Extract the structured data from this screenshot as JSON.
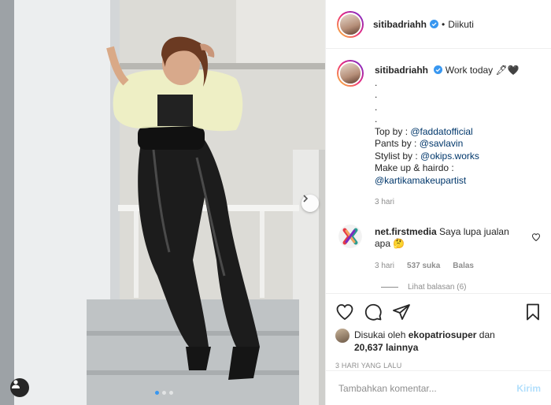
{
  "header": {
    "username": "sitibadriahh",
    "separator": "•",
    "follow_status": "Diikuti"
  },
  "caption": {
    "username": "sitibadriahh",
    "text": "Work today",
    "emoji": "🖋🖤",
    "dots": [
      ".",
      ".",
      ".",
      "."
    ],
    "lines": [
      {
        "prefix": "Top by : ",
        "mention": "@faddatofficial"
      },
      {
        "prefix": "Pants by : ",
        "mention": "@savlavin"
      },
      {
        "prefix": "Stylist by : ",
        "mention": "@okips.works"
      },
      {
        "prefix": "Make up & hairdo :",
        "mention": ""
      },
      {
        "prefix": "",
        "mention": "@kartikamakeupartist"
      }
    ],
    "time": "3 hari"
  },
  "comment": {
    "username": "net.firstmedia",
    "text": "Saya lupa jualan apa 🤔",
    "time": "3 hari",
    "likes": "537 suka",
    "reply": "Balas",
    "view_replies": "Lihat balasan (6)"
  },
  "likes": {
    "prefix": "Disukai oleh",
    "user": "ekopatriosuper",
    "connector": "dan",
    "count": "20,637 lainnya"
  },
  "posted_ago": "3 HARI YANG LALU",
  "add_comment": {
    "placeholder": "Tambahkan komentar...",
    "post_label": "Kirim"
  },
  "colors": {
    "link": "#00376b",
    "verified": "#3897f0",
    "muted": "#8e8e8e",
    "post_button_disabled": "#b2dffc"
  },
  "icons": [
    "heart-icon",
    "comment-icon",
    "share-icon",
    "bookmark-icon",
    "chevron-right-icon",
    "user-tag-icon",
    "verified-badge-icon"
  ]
}
